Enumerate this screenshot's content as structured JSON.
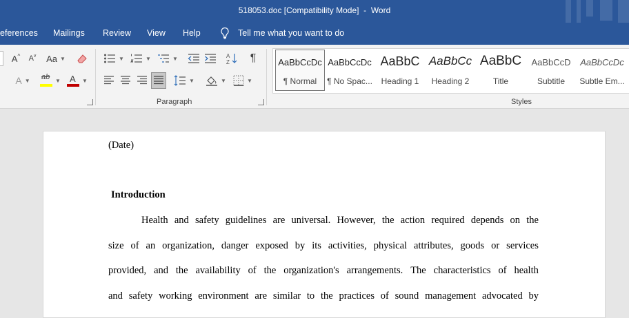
{
  "window": {
    "title": "518053.doc [Compatibility Mode]  -  Word"
  },
  "menu": {
    "tabs": [
      "eferences",
      "Mailings",
      "Review",
      "View",
      "Help"
    ],
    "tell_me": "Tell me what you want to do"
  },
  "ribbon": {
    "font_group": {
      "grow_font": "A",
      "shrink_font": "A",
      "change_case": "Aa",
      "font_color_letter": "A",
      "highlight_text": "ab",
      "text_effects": "A"
    },
    "paragraph_group": {
      "label": "Paragraph"
    },
    "styles_group": {
      "label": "Styles",
      "items": [
        {
          "preview": "AaBbCcDc",
          "name": "¶ Normal"
        },
        {
          "preview": "AaBbCcDc",
          "name": "¶ No Spac..."
        },
        {
          "preview": "AaBbC",
          "name": "Heading 1"
        },
        {
          "preview": "AaBbCc",
          "name": "Heading 2"
        },
        {
          "preview": "AaBbC",
          "name": "Title"
        },
        {
          "preview": "AaBbCcD",
          "name": "Subtitle"
        },
        {
          "preview": "AaBbCcDc",
          "name": "Subtle Em..."
        }
      ]
    },
    "colors": {
      "highlight": "#ffff00",
      "font_color": "#c00000",
      "title_bar": "#2b579a"
    }
  },
  "document": {
    "date_line": "(Date)",
    "heading": "Introduction",
    "para_lines": [
      "Health and safety guidelines are universal. However, the action required depends on the",
      "size of an organization, danger exposed by its activities, physical attributes, goods or services",
      "provided, and the availability of the organization's arrangements. The characteristics of health",
      "and safety working environment are similar to the practices of sound management advocated by"
    ]
  }
}
